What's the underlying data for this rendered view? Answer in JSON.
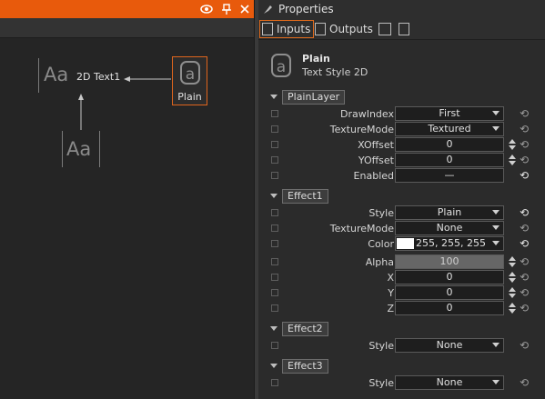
{
  "left_panel": {
    "header_icons": [
      "eye-icon",
      "pin-icon",
      "close-icon"
    ],
    "graph": {
      "source_node": {
        "glyph": "Aa",
        "label": "2D Text1"
      },
      "style_node": {
        "label": "Plain"
      },
      "input_node": {
        "glyph": "Aa"
      }
    }
  },
  "properties": {
    "title": "Properties",
    "tabs": [
      {
        "label": "Inputs",
        "active": true
      },
      {
        "label": "Outputs",
        "active": false
      }
    ],
    "object": {
      "name": "Plain",
      "type": "Text Style 2D"
    },
    "groups": [
      {
        "name": "PlainLayer",
        "rows": [
          {
            "label": "DrawIndex",
            "value": "First",
            "kind": "combo"
          },
          {
            "label": "TextureMode",
            "value": "Textured",
            "kind": "combo"
          },
          {
            "label": "XOffset",
            "value": "0",
            "kind": "spin"
          },
          {
            "label": "YOffset",
            "value": "0",
            "kind": "spin"
          },
          {
            "label": "Enabled",
            "value": "—",
            "kind": "plain"
          }
        ]
      },
      {
        "name": "Effect1",
        "rows": [
          {
            "label": "Style",
            "value": "Plain",
            "kind": "combo"
          },
          {
            "label": "TextureMode",
            "value": "None",
            "kind": "combo"
          },
          {
            "label": "Color",
            "value": "255, 255, 255",
            "kind": "color",
            "swatch": "#ffffff"
          },
          {
            "label": "Alpha",
            "value": "100",
            "kind": "disabled"
          },
          {
            "label": "X",
            "value": "0",
            "kind": "spin"
          },
          {
            "label": "Y",
            "value": "0",
            "kind": "spin"
          },
          {
            "label": "Z",
            "value": "0",
            "kind": "spin"
          }
        ]
      },
      {
        "name": "Effect2",
        "rows": [
          {
            "label": "Style",
            "value": "None",
            "kind": "combo"
          }
        ]
      },
      {
        "name": "Effect3",
        "rows": [
          {
            "label": "Style",
            "value": "None",
            "kind": "combo"
          }
        ]
      }
    ]
  },
  "colors": {
    "accent": "#e85a0c",
    "panel_bg": "#2b2b2b",
    "graph_bg": "#252525"
  }
}
